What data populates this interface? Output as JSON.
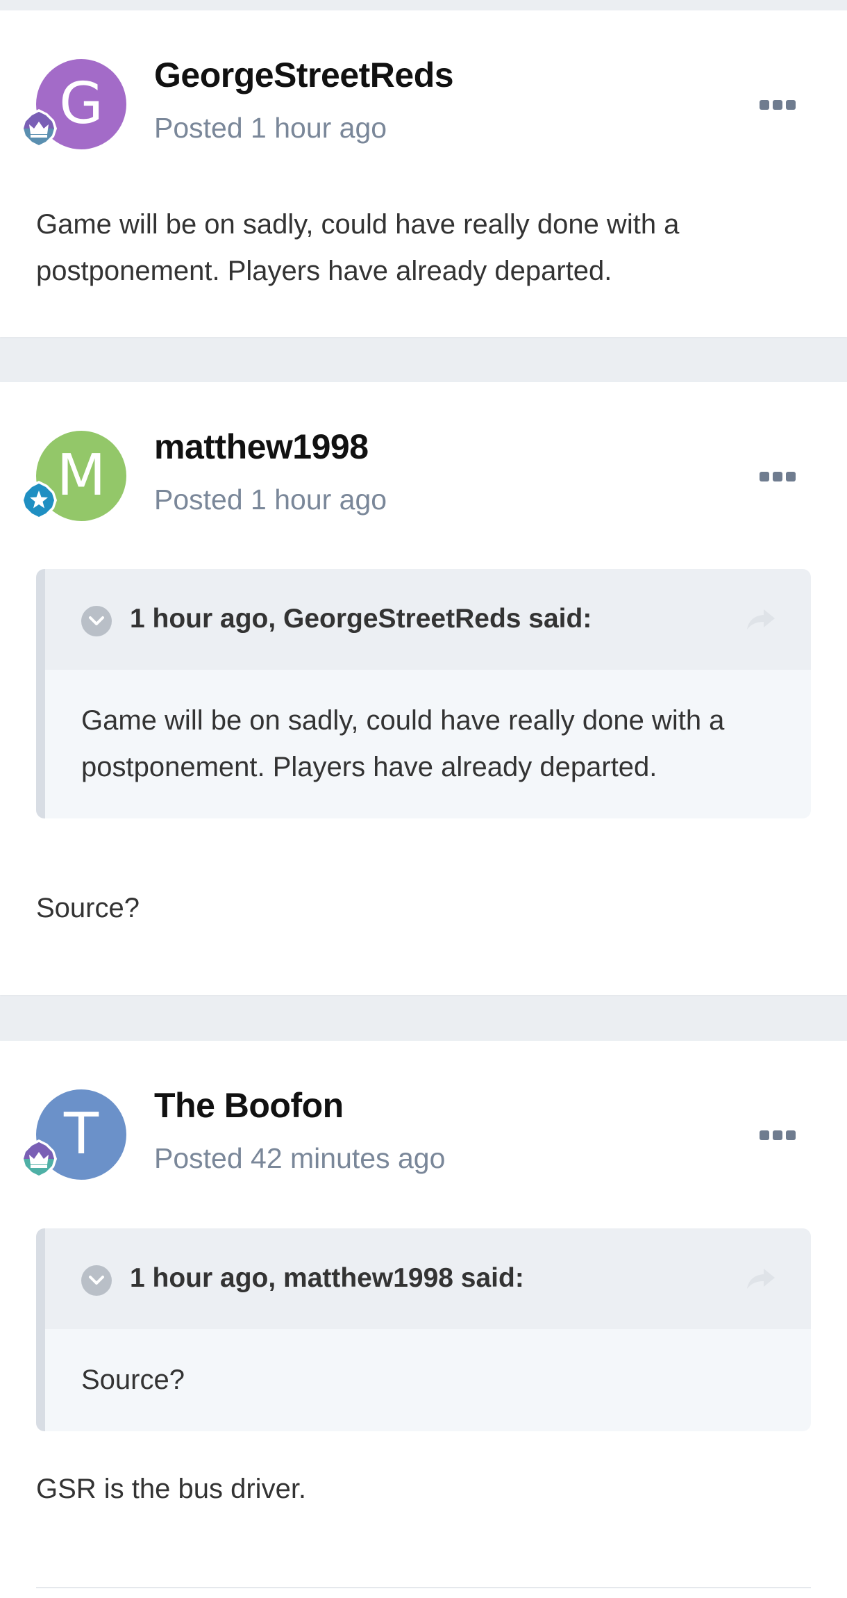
{
  "posts": [
    {
      "author": "GeorgeStreetReds",
      "avatar_letter": "G",
      "avatar_color": "#a36bc8",
      "rank_icon": "crown-badge-icon",
      "meta": "Posted 1 hour ago",
      "content": "Game will be on sadly, could have really done with a postponement. Players have already departed."
    },
    {
      "author": "matthew1998",
      "avatar_letter": "M",
      "avatar_color": "#93c769",
      "rank_icon": "star-badge-icon",
      "meta": "Posted 1 hour ago",
      "quote": {
        "citation": "1 hour ago, GeorgeStreetReds said:",
        "text": "Game will be on sadly, could have really done with a postponement. Players have already departed."
      },
      "content": "Source?"
    },
    {
      "author": "The Boofon",
      "avatar_letter": "T",
      "avatar_color": "#6b91c9",
      "rank_icon": "crown-badge-icon",
      "meta": "Posted 42 minutes ago",
      "quote": {
        "citation": "1 hour ago, matthew1998 said:",
        "text": "Source?"
      },
      "content": "GSR is the bus driver."
    }
  ],
  "colors": {
    "page_background": "#ebeef2",
    "meta_text": "#7a8799",
    "quote_background": "#f4f7fa"
  }
}
